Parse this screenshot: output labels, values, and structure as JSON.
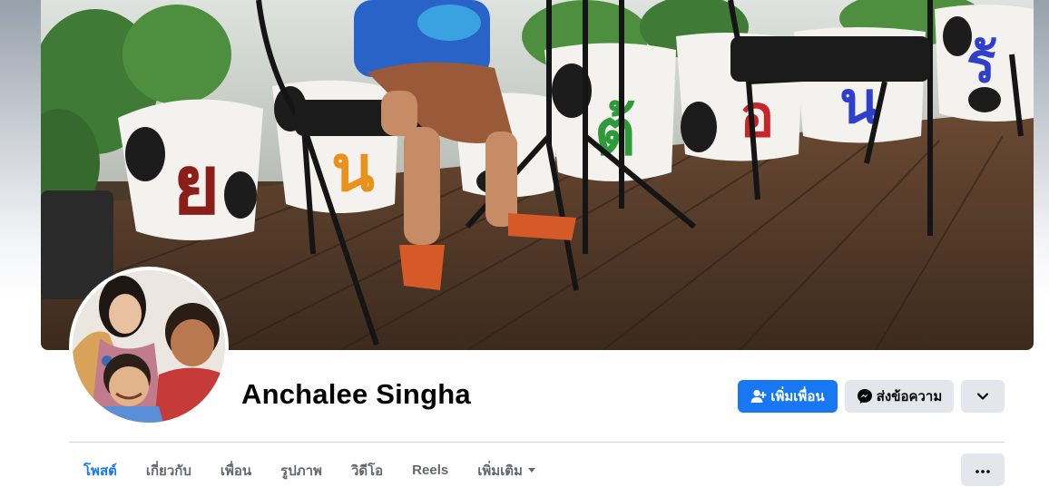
{
  "profile": {
    "name": "Anchalee Singha"
  },
  "actions": {
    "add_friend_label": "เพิ่มเพื่อน",
    "message_label": "ส่งข้อความ",
    "dropdown_icon": "chevron-down-icon"
  },
  "tabs": [
    {
      "label": "โพสต์",
      "active": true
    },
    {
      "label": "เกี่ยวกับ",
      "active": false
    },
    {
      "label": "เพื่อน",
      "active": false
    },
    {
      "label": "รูปภาพ",
      "active": false
    },
    {
      "label": "วิดีโอ",
      "active": false
    },
    {
      "label": "Reels",
      "active": false
    },
    {
      "label": "เพิ่มเติม",
      "active": false
    }
  ],
  "colors": {
    "accent": "#1877f2",
    "button_gray": "#e4e6eb",
    "tab_text": "#65676b"
  }
}
